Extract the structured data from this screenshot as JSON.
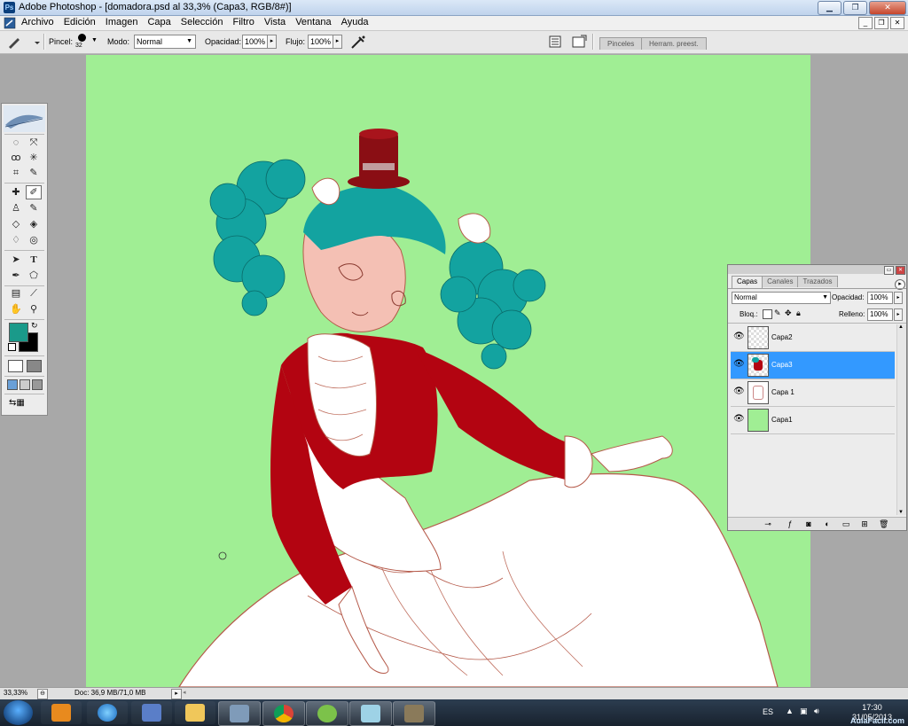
{
  "window": {
    "title": "Adobe Photoshop - [domadora.psd al 33,3% (Capa3, RGB/8#)]",
    "app_icon": "ps-icon",
    "buttons": [
      "minimize-icon",
      "restore-icon",
      "close-icon"
    ]
  },
  "menubar": {
    "items": [
      "Archivo",
      "Edición",
      "Imagen",
      "Capa",
      "Selección",
      "Filtro",
      "Vista",
      "Ventana",
      "Ayuda"
    ]
  },
  "options": {
    "pincel_label": "Pincel:",
    "brush_size": "32",
    "modo_label": "Modo:",
    "modo_value": "Normal",
    "opacidad_label": "Opacidad:",
    "opacidad_value": "100%",
    "flujo_label": "Flujo:",
    "flujo_value": "100%",
    "palette_tabs": [
      "Pinceles",
      "Herram. preest."
    ]
  },
  "toolbox": {
    "tools": [
      "marquee-icon",
      "move-icon",
      "lasso-icon",
      "magic-wand-icon",
      "crop-icon",
      "slice-icon",
      "healing-brush-icon",
      "brush-icon",
      "clone-stamp-icon",
      "history-brush-icon",
      "eraser-icon",
      "paint-bucket-icon",
      "blur-icon",
      "dodge-icon",
      "path-select-icon",
      "text-icon",
      "pen-icon",
      "shape-icon",
      "notes-icon",
      "eyedropper-icon",
      "hand-icon",
      "zoom-icon"
    ],
    "text_tool_glyph": "T",
    "foreground_color": "#1a9a8a",
    "background_color": "#000000"
  },
  "layers_panel": {
    "tabs": [
      "Capas",
      "Canales",
      "Trazados"
    ],
    "blend_mode": "Normal",
    "opacidad_label": "Opacidad:",
    "opacidad_value": "100%",
    "bloq_label": "Bloq.:",
    "relleno_label": "Relleno:",
    "relleno_value": "100%",
    "layers": [
      {
        "name": "Capa2",
        "visible": true,
        "active": false,
        "thumb": "transparent"
      },
      {
        "name": "Capa3",
        "visible": true,
        "active": true,
        "thumb": "figure"
      },
      {
        "name": "Capa 1",
        "visible": true,
        "active": false,
        "thumb": "sketch"
      },
      {
        "name": "Capa1",
        "visible": true,
        "active": false,
        "thumb": "#a0ee94"
      }
    ]
  },
  "statusbar": {
    "zoom": "33,33%",
    "doc": "Doc: 36,9 MB/71,0 MB"
  },
  "taskbar": {
    "apps": [
      "media-player-icon",
      "internet-explorer-icon",
      "paint-icon",
      "file-explorer-icon",
      "network-icon",
      "chrome-icon",
      "photo-app-icon",
      "feather-app-icon",
      "photoshop-brush-icon"
    ],
    "language": "ES",
    "time": "17:30",
    "date": "31/05/2013",
    "watermark": "AulaFacil.com"
  },
  "colors": {
    "canvas_background": "#a0ee94",
    "selected_layer": "#3399ff"
  }
}
